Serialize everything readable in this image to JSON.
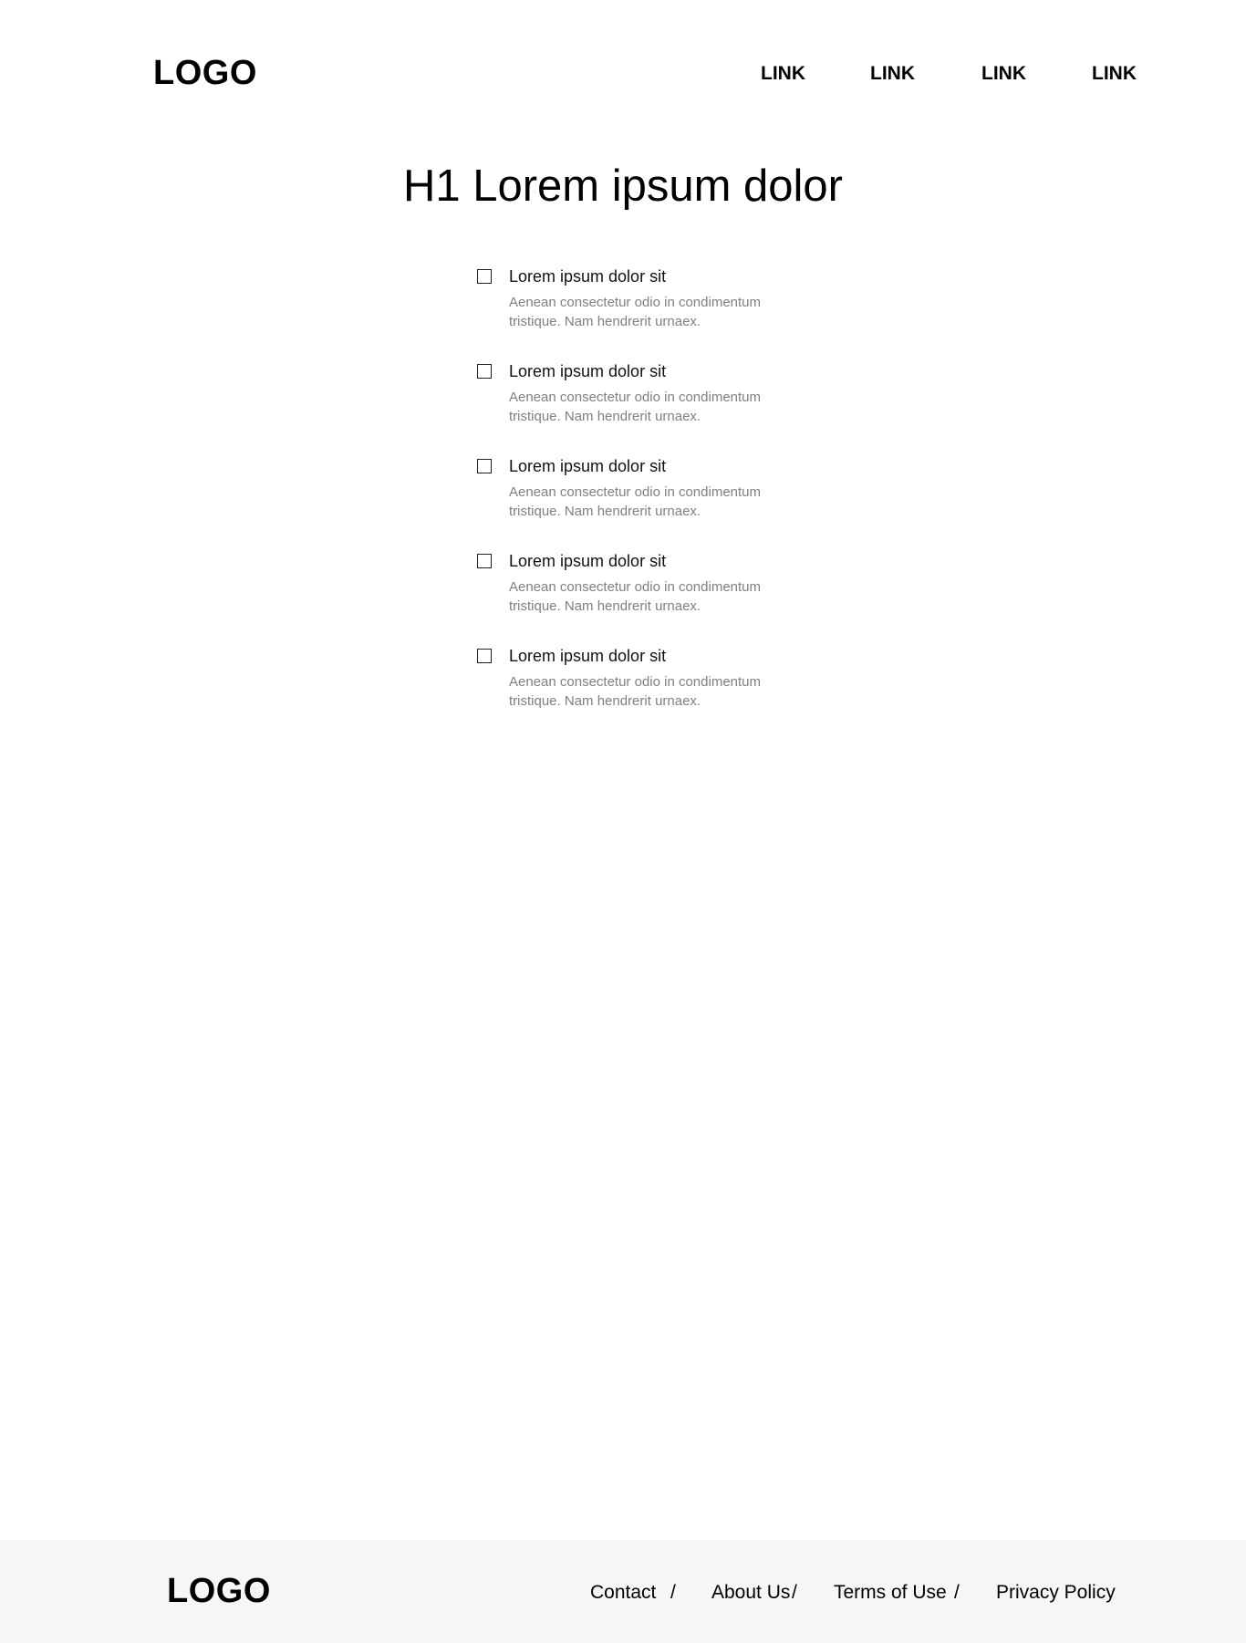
{
  "header": {
    "logo": "LOGO",
    "nav": [
      "LINK",
      "LINK",
      "LINK",
      "LINK"
    ]
  },
  "main": {
    "title": "H1 Lorem ipsum dolor",
    "items": [
      {
        "title": "Lorem ipsum dolor sit",
        "description": "Aenean consectetur odio in condimentum tristique. Nam hendrerit urnaex.",
        "checked": false
      },
      {
        "title": "Lorem ipsum dolor sit",
        "description": "Aenean consectetur odio in condimentum tristique. Nam hendrerit urnaex.",
        "checked": false
      },
      {
        "title": "Lorem ipsum dolor sit",
        "description": "Aenean consectetur odio in condimentum tristique. Nam hendrerit urnaex.",
        "checked": false
      },
      {
        "title": "Lorem ipsum dolor sit",
        "description": "Aenean consectetur odio in condimentum tristique. Nam hendrerit urnaex.",
        "checked": false
      },
      {
        "title": "Lorem ipsum dolor sit",
        "description": "Aenean consectetur odio in condimentum tristique. Nam hendrerit urnaex.",
        "checked": false
      }
    ]
  },
  "footer": {
    "logo": "LOGO",
    "links": [
      "Contact",
      "About Us",
      "Terms of Use",
      "Privacy Policy"
    ],
    "separator": "/"
  },
  "colors": {
    "footer_background": "#f5f6f8",
    "description_text": "#808080",
    "text": "#000000"
  }
}
